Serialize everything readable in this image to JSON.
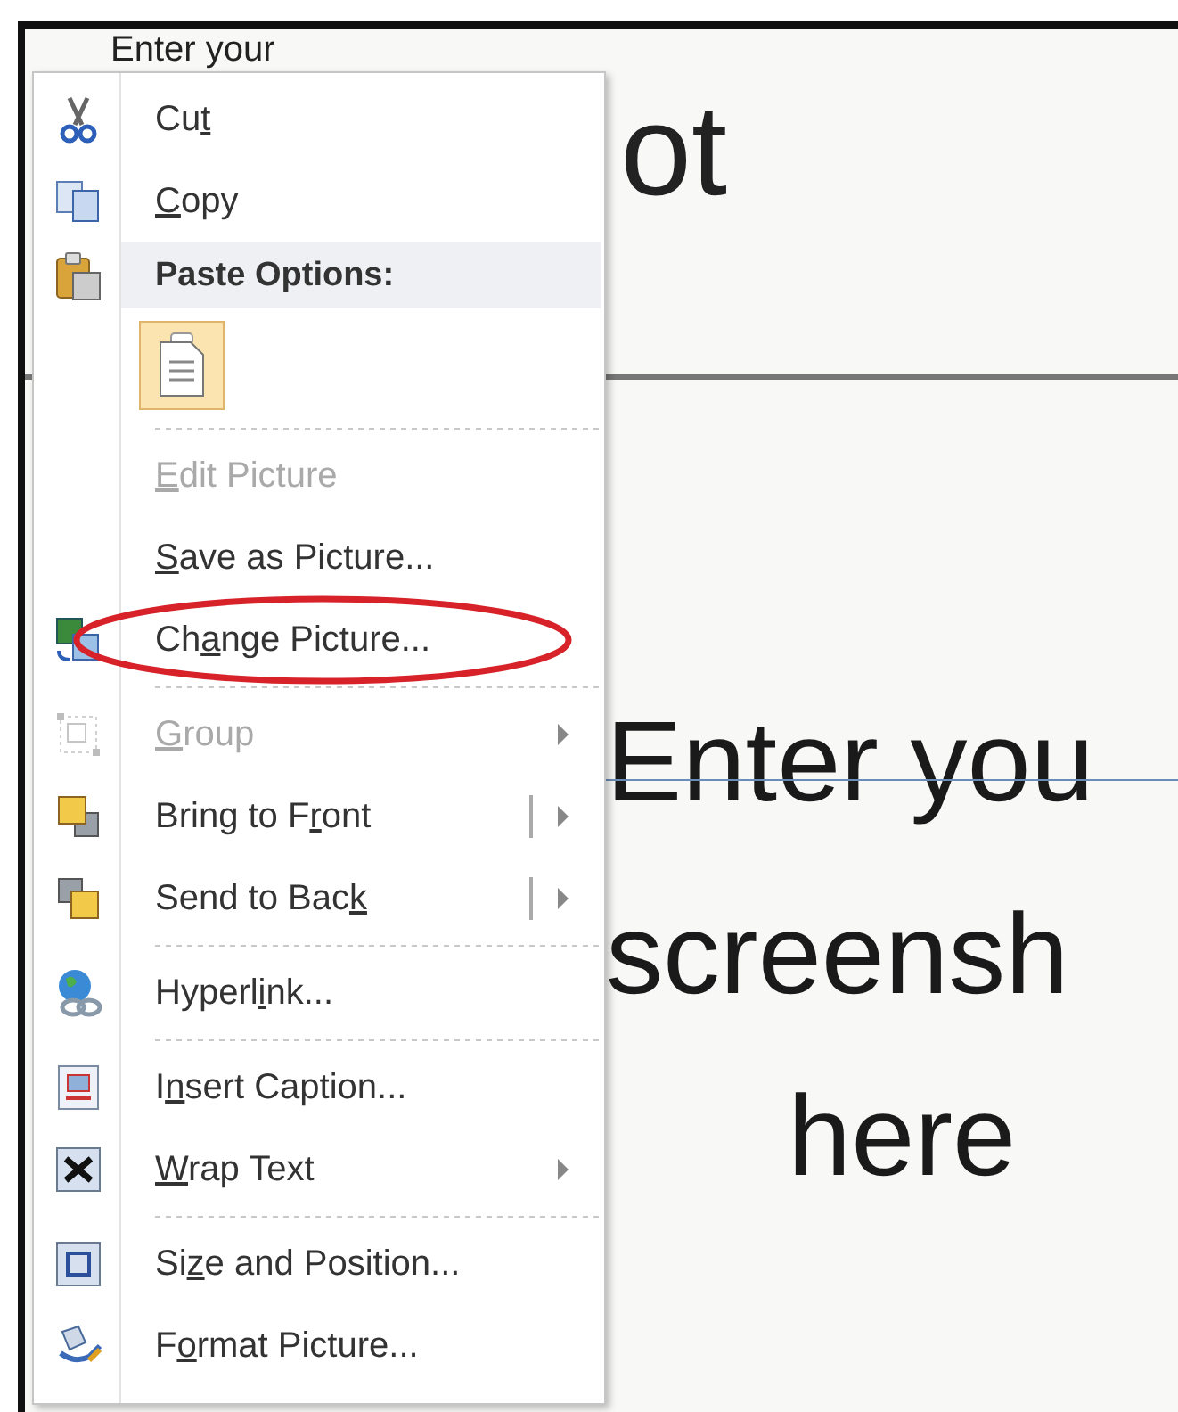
{
  "slide": {
    "top_texts": [
      "Enter your",
      "ot"
    ],
    "body_texts": [
      "Enter you",
      "screensh",
      "here"
    ]
  },
  "menu": {
    "items": [
      {
        "kind": "command",
        "before": "Cu",
        "key": "t",
        "disabled": false,
        "submenu": false,
        "split": false,
        "circled": false
      },
      {
        "kind": "command",
        "key": "C",
        "after": "opy",
        "disabled": false,
        "submenu": false,
        "split": false,
        "circled": false
      },
      {
        "kind": "header",
        "label": "Paste Options:"
      },
      {
        "kind": "paste"
      },
      {
        "kind": "separator"
      },
      {
        "kind": "command",
        "key": "E",
        "after": "dit Picture",
        "disabled": true,
        "submenu": false,
        "split": false,
        "circled": false
      },
      {
        "kind": "command",
        "key": "S",
        "after": "ave as Picture...",
        "disabled": false,
        "submenu": false,
        "split": false,
        "circled": false
      },
      {
        "kind": "command",
        "before": "Ch",
        "key": "a",
        "after": "nge Picture...",
        "disabled": false,
        "submenu": false,
        "split": false,
        "circled": true
      },
      {
        "kind": "separator"
      },
      {
        "kind": "command",
        "key": "G",
        "after": "roup",
        "disabled": true,
        "submenu": true,
        "split": false,
        "circled": false
      },
      {
        "kind": "command",
        "before": "Bring to F",
        "key": "r",
        "after": "ont",
        "disabled": false,
        "submenu": true,
        "split": true,
        "circled": false
      },
      {
        "kind": "command",
        "before": "Send to Bac",
        "key": "k",
        "disabled": false,
        "submenu": true,
        "split": true,
        "circled": false
      },
      {
        "kind": "separator"
      },
      {
        "kind": "command",
        "before": "Hyperl",
        "key": "i",
        "after": "nk...",
        "disabled": false,
        "submenu": false,
        "split": false,
        "circled": false
      },
      {
        "kind": "separator"
      },
      {
        "kind": "command",
        "before": "I",
        "key": "n",
        "after": "sert Caption...",
        "disabled": false,
        "submenu": false,
        "split": false,
        "circled": false
      },
      {
        "kind": "command",
        "key": "W",
        "after": "rap Text",
        "disabled": false,
        "submenu": true,
        "split": false,
        "circled": false
      },
      {
        "kind": "separator"
      },
      {
        "kind": "command",
        "before": "Si",
        "key": "z",
        "after": "e and Position...",
        "disabled": false,
        "submenu": false,
        "split": false,
        "circled": false
      },
      {
        "kind": "command",
        "before": "F",
        "key": "o",
        "after": "rmat Picture...",
        "disabled": false,
        "submenu": false,
        "split": false,
        "circled": false
      }
    ]
  }
}
